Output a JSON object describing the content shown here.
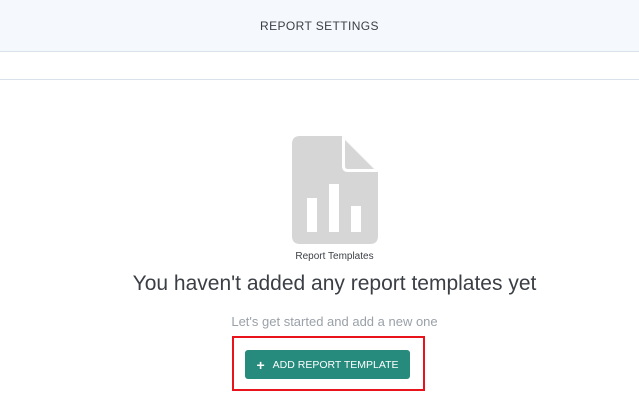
{
  "header": {
    "title": "REPORT SETTINGS"
  },
  "empty_state": {
    "icon": "document-chart-icon",
    "icon_caption": "Report Templates",
    "title": "You haven't added any report templates yet",
    "subtitle": "Let's get started and add a new one"
  },
  "actions": {
    "add_button_icon": "plus-icon",
    "add_button_label": "ADD REPORT TEMPLATE"
  },
  "colors": {
    "button": "#268a7c",
    "highlight": "#e8131b",
    "icon": "#d6d6d6"
  }
}
